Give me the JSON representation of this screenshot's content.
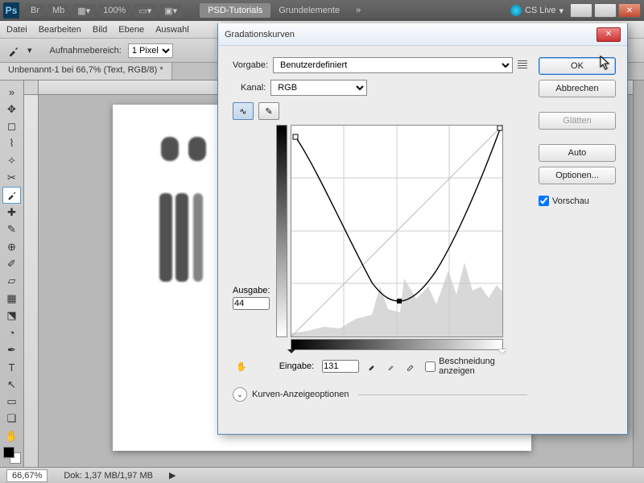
{
  "app": {
    "ps": "Ps",
    "zoom_chip": "100%",
    "br": "Br",
    "mb": "Mb"
  },
  "tabs": {
    "active": "PSD-Tutorials",
    "other": "Grundelemente",
    "more": "»"
  },
  "cslive": "CS Live",
  "menu": [
    "Datei",
    "Bearbeiten",
    "Bild",
    "Ebene",
    "Auswahl"
  ],
  "optbar": {
    "label": "Aufnahmebereich:",
    "value": "1 Pixel"
  },
  "doctab": "Unbenannt-1 bei 66,7% (Text, RGB/8) *",
  "status": {
    "zoom": "66,67%",
    "doc": "Dok: 1,37 MB/1,97 MB"
  },
  "dialog": {
    "title": "Gradationskurven",
    "preset_label": "Vorgabe:",
    "preset_value": "Benutzerdefiniert",
    "channel_label": "Kanal:",
    "channel_value": "RGB",
    "output_label": "Ausgabe:",
    "output_value": "44",
    "input_label": "Eingabe:",
    "input_value": "131",
    "clip_label": "Beschneidung anzeigen",
    "options_label": "Kurven-Anzeigeoptionen",
    "ok": "OK",
    "cancel": "Abbrechen",
    "smooth": "Glätten",
    "auto": "Auto",
    "opts": "Optionen...",
    "preview": "Vorschau"
  },
  "chart_data": {
    "type": "line",
    "title": "Gradationskurven",
    "xlabel": "Eingabe",
    "ylabel": "Ausgabe",
    "xlim": [
      0,
      255
    ],
    "ylim": [
      0,
      255
    ],
    "series": [
      {
        "name": "curve",
        "values": [
          {
            "x": 0,
            "y": 246
          },
          {
            "x": 30,
            "y": 210
          },
          {
            "x": 60,
            "y": 150
          },
          {
            "x": 90,
            "y": 90
          },
          {
            "x": 110,
            "y": 60
          },
          {
            "x": 131,
            "y": 44
          },
          {
            "x": 150,
            "y": 50
          },
          {
            "x": 175,
            "y": 80
          },
          {
            "x": 200,
            "y": 130
          },
          {
            "x": 225,
            "y": 190
          },
          {
            "x": 255,
            "y": 255
          }
        ]
      }
    ],
    "control_points": [
      {
        "x": 5,
        "y": 242,
        "selected": false
      },
      {
        "x": 131,
        "y": 44,
        "selected": true
      },
      {
        "x": 255,
        "y": 255,
        "selected": false
      }
    ]
  }
}
